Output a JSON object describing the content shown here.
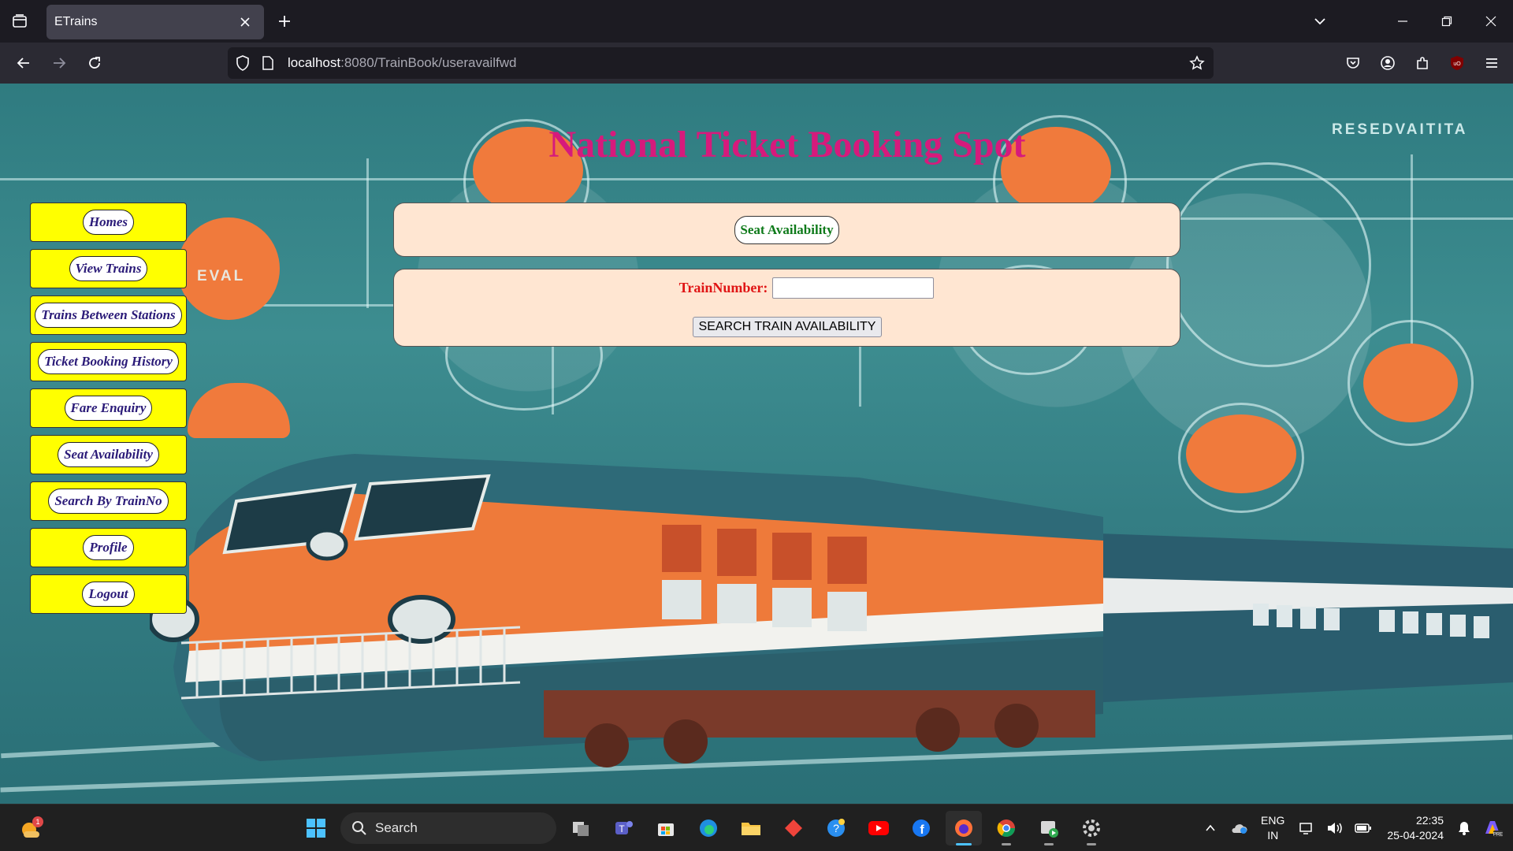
{
  "browser": {
    "tab_title": "ETrains",
    "url_host": "localhost",
    "url_rest": ":8080/TrainBook/useravailfwd"
  },
  "page": {
    "site_title": "National Ticket Booking Spot",
    "menu": [
      {
        "label": "Homes"
      },
      {
        "label": "View Trains"
      },
      {
        "label": "Trains Between Stations"
      },
      {
        "label": "Ticket Booking History"
      },
      {
        "label": "Fare Enquiry"
      },
      {
        "label": "Seat Availability"
      },
      {
        "label": "Search By TrainNo"
      },
      {
        "label": "Profile"
      },
      {
        "label": "Logout"
      }
    ],
    "section_heading": "Seat Availability",
    "form": {
      "train_number_label": "TrainNumber:",
      "train_number_value": "",
      "submit_label": "SEARCH TRAIN AVAILABILITY"
    },
    "background": {
      "sign_right": "RESEDVAITITA",
      "sign_left": "EVAL"
    }
  },
  "taskbar": {
    "search_label": "Search",
    "notification_count": "1",
    "lang_top": "ENG",
    "lang_bottom": "IN",
    "time": "22:35",
    "date": "25-04-2024"
  },
  "colors": {
    "title": "#d61a7c",
    "menu_bg": "#ffff00",
    "menu_text": "#2a1a78",
    "panel_bg": "#ffe6d2",
    "heading_text": "#0e7a1a",
    "label_text": "#e01515"
  }
}
